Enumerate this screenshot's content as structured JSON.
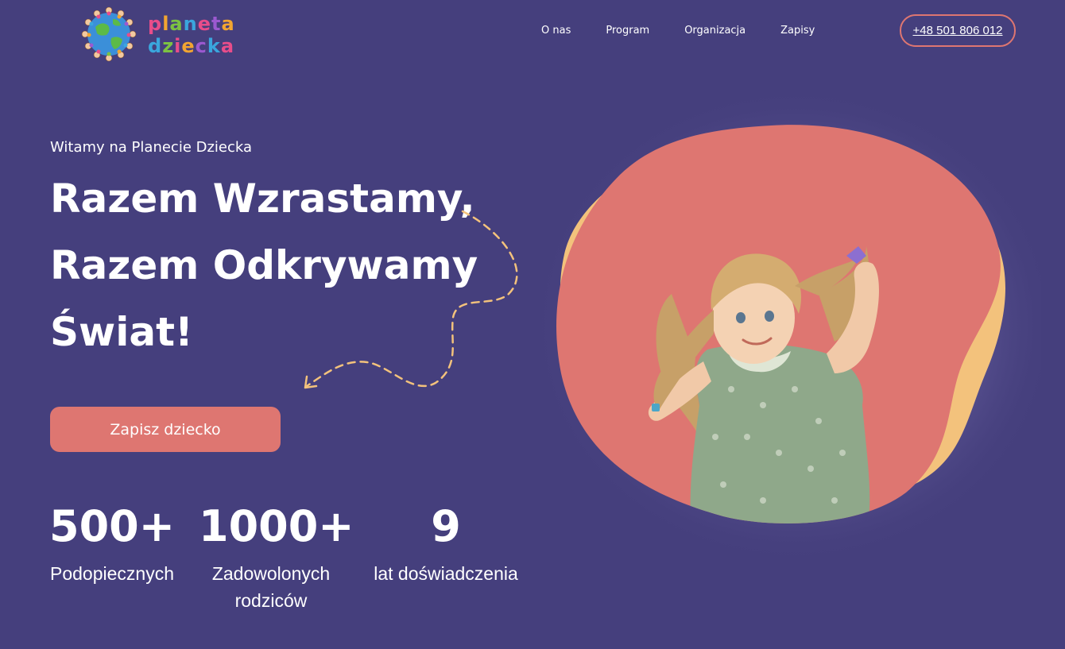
{
  "brand": {
    "logo_line1": "planeta",
    "logo_line2": "dziecka",
    "logo_line1_colors": [
      "#e84d8a",
      "#f2a531",
      "#7cc242",
      "#3aa6dd",
      "#e84d8a",
      "#9b59d0",
      "#f2a531"
    ],
    "logo_line2_colors": [
      "#3aa6dd",
      "#7cc242",
      "#e84d8a",
      "#f2a531",
      "#9b59d0",
      "#3aa6dd",
      "#e84d8a"
    ]
  },
  "nav": {
    "items": [
      {
        "label": "O nas"
      },
      {
        "label": "Program"
      },
      {
        "label": "Organizacja"
      },
      {
        "label": "Zapisy"
      }
    ]
  },
  "header": {
    "phone": "+48 501 806 012"
  },
  "hero": {
    "subtitle": "Witamy na Planecie Dziecka",
    "title_lines": [
      "Razem Wzrastamy,",
      "Razem Odkrywamy",
      "Świat!"
    ],
    "cta_label": "Zapisz dziecko"
  },
  "stats": [
    {
      "value": "500+",
      "label_lines": [
        "Podopiecznych"
      ]
    },
    {
      "value": "1000+",
      "label_lines": [
        "Zadowolonych",
        "rodziców"
      ]
    },
    {
      "value": "9",
      "label_lines": [
        "lat doświadczenia"
      ]
    }
  ],
  "colors": {
    "background": "#453f7d",
    "accent": "#de7671",
    "blob_back": "#f3c27c",
    "dashed_line": "#f3c27c"
  },
  "icons": {
    "logo": "globe-with-children-icon",
    "path": "dashed-arrow-icon"
  }
}
